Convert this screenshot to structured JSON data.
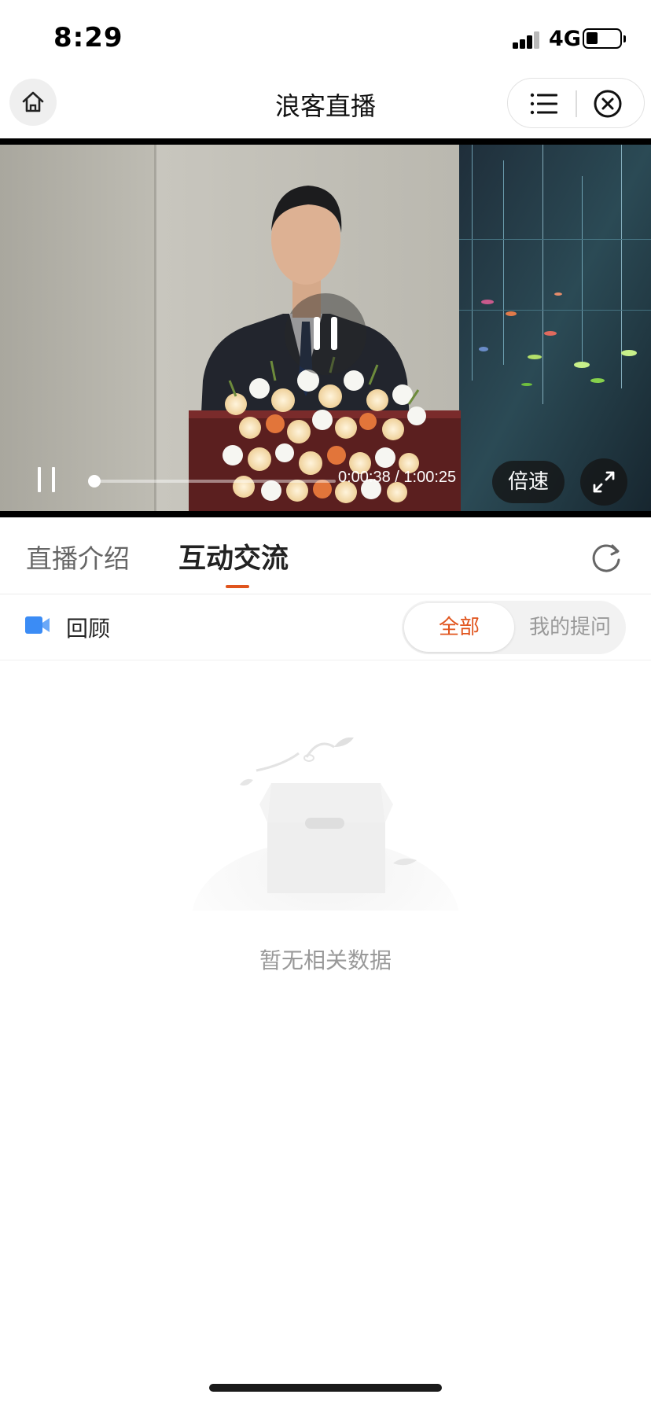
{
  "status_bar": {
    "time": "8:29",
    "network": "4G"
  },
  "nav": {
    "title": "浪客直播",
    "home_icon": "home-icon",
    "menu_icon": "list-icon",
    "close_icon": "close-circle-icon"
  },
  "video": {
    "elapsed": "0:00:38",
    "total": "1:00:25",
    "time_readout": "0:00:38 / 1:00:25",
    "progress": 0.0105,
    "speed_label": "倍速",
    "center_icon": "pause-icon",
    "fullscreen_icon": "fullscreen-icon"
  },
  "tabs": [
    {
      "label": "直播介绍",
      "active": false
    },
    {
      "label": "互动交流",
      "active": true
    }
  ],
  "filter": {
    "replay_label": "回顾",
    "replay_icon": "video-camera-icon",
    "options": [
      {
        "label": "全部",
        "selected": true
      },
      {
        "label": "我的提问",
        "selected": false
      }
    ]
  },
  "empty_state": {
    "message": "暂无相关数据",
    "icon": "empty-box-icon"
  },
  "colors": {
    "accent": "#e0541d",
    "replay_icon": "#3b8cf5",
    "muted_text": "#999999"
  }
}
